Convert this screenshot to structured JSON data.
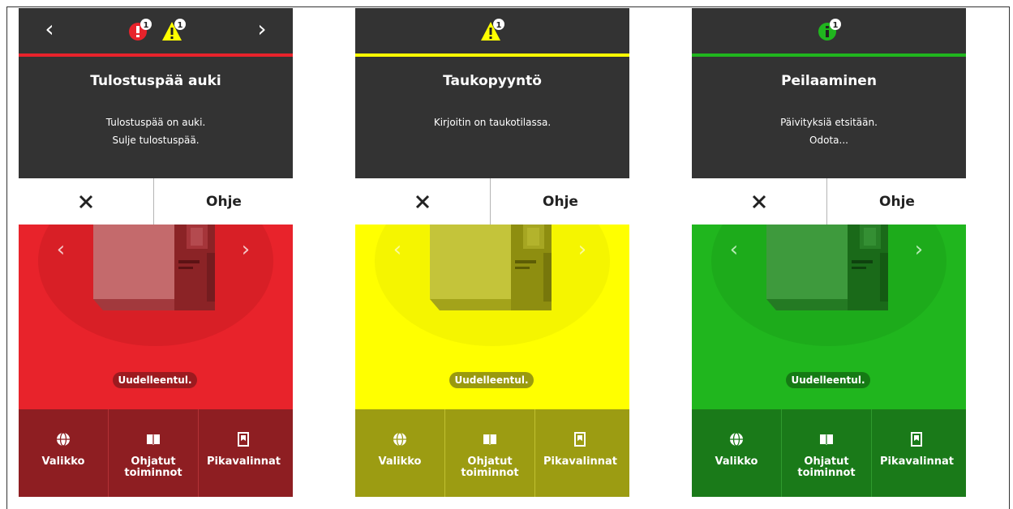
{
  "common": {
    "close_symbol": "✕",
    "help_label": "Ohje",
    "reprint_label": "Uudelleentul.",
    "nav_prev": "‹",
    "nav_next": "›",
    "tiles": [
      "Valikko",
      "Ohjatut toiminnot",
      "Pikavalinnat"
    ],
    "badge_count": "1"
  },
  "screens": [
    {
      "status": "error",
      "accent": "#e8232b",
      "title": "Tulostuspää auki",
      "message_line1": "Tulostuspää on auki.",
      "message_line2": "Sulje tulostuspää.",
      "status_icons": [
        "error-icon",
        "warning-icon"
      ],
      "has_nav_arrows": true
    },
    {
      "status": "warning",
      "accent": "#ffff00",
      "title": "Taukopyyntö",
      "message_line1": "Kirjoitin on taukotilassa.",
      "message_line2": "",
      "status_icons": [
        "warning-icon"
      ],
      "has_nav_arrows": false
    },
    {
      "status": "info",
      "accent": "#20b61e",
      "title": "Peilaaminen",
      "message_line1": "Päivityksiä etsitään.",
      "message_line2": "Odota...",
      "status_icons": [
        "info-icon"
      ],
      "has_nav_arrows": false
    }
  ]
}
